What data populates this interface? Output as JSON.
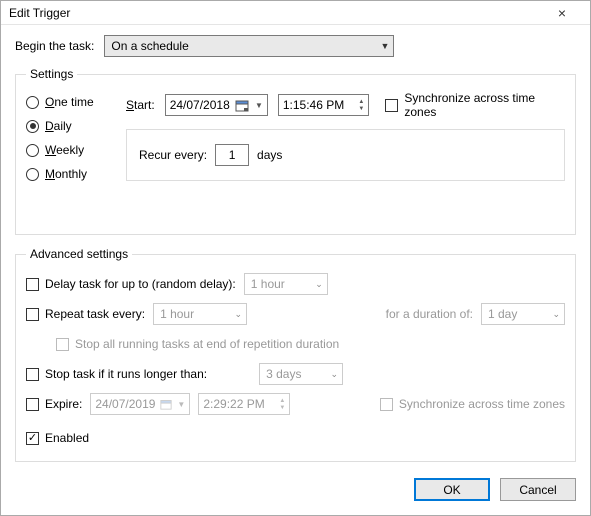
{
  "window": {
    "title": "Edit Trigger"
  },
  "begin": {
    "label": "Begin the task:",
    "value": "On a schedule"
  },
  "settings": {
    "legend": "Settings",
    "radios": {
      "one_time": "One time",
      "daily": "Daily",
      "weekly": "Weekly",
      "monthly": "Monthly",
      "selected": "daily"
    },
    "start_label": "Start:",
    "start_date": "24/07/2018",
    "start_time": "1:15:46 PM",
    "sync_label": "Synchronize across time zones",
    "recur_label": "Recur every:",
    "recur_value": "1",
    "recur_unit": "days"
  },
  "advanced": {
    "legend": "Advanced settings",
    "delay_label": "Delay task for up to (random delay):",
    "delay_value": "1 hour",
    "repeat_label": "Repeat task every:",
    "repeat_value": "1 hour",
    "duration_label": "for a duration of:",
    "duration_value": "1 day",
    "stop_all_label": "Stop all running tasks at end of repetition duration",
    "stop_long_label": "Stop task if it runs longer than:",
    "stop_long_value": "3 days",
    "expire_label": "Expire:",
    "expire_date": "24/07/2019",
    "expire_time": "2:29:22 PM",
    "expire_sync_label": "Synchronize across time zones",
    "enabled_label": "Enabled"
  },
  "buttons": {
    "ok": "OK",
    "cancel": "Cancel"
  }
}
